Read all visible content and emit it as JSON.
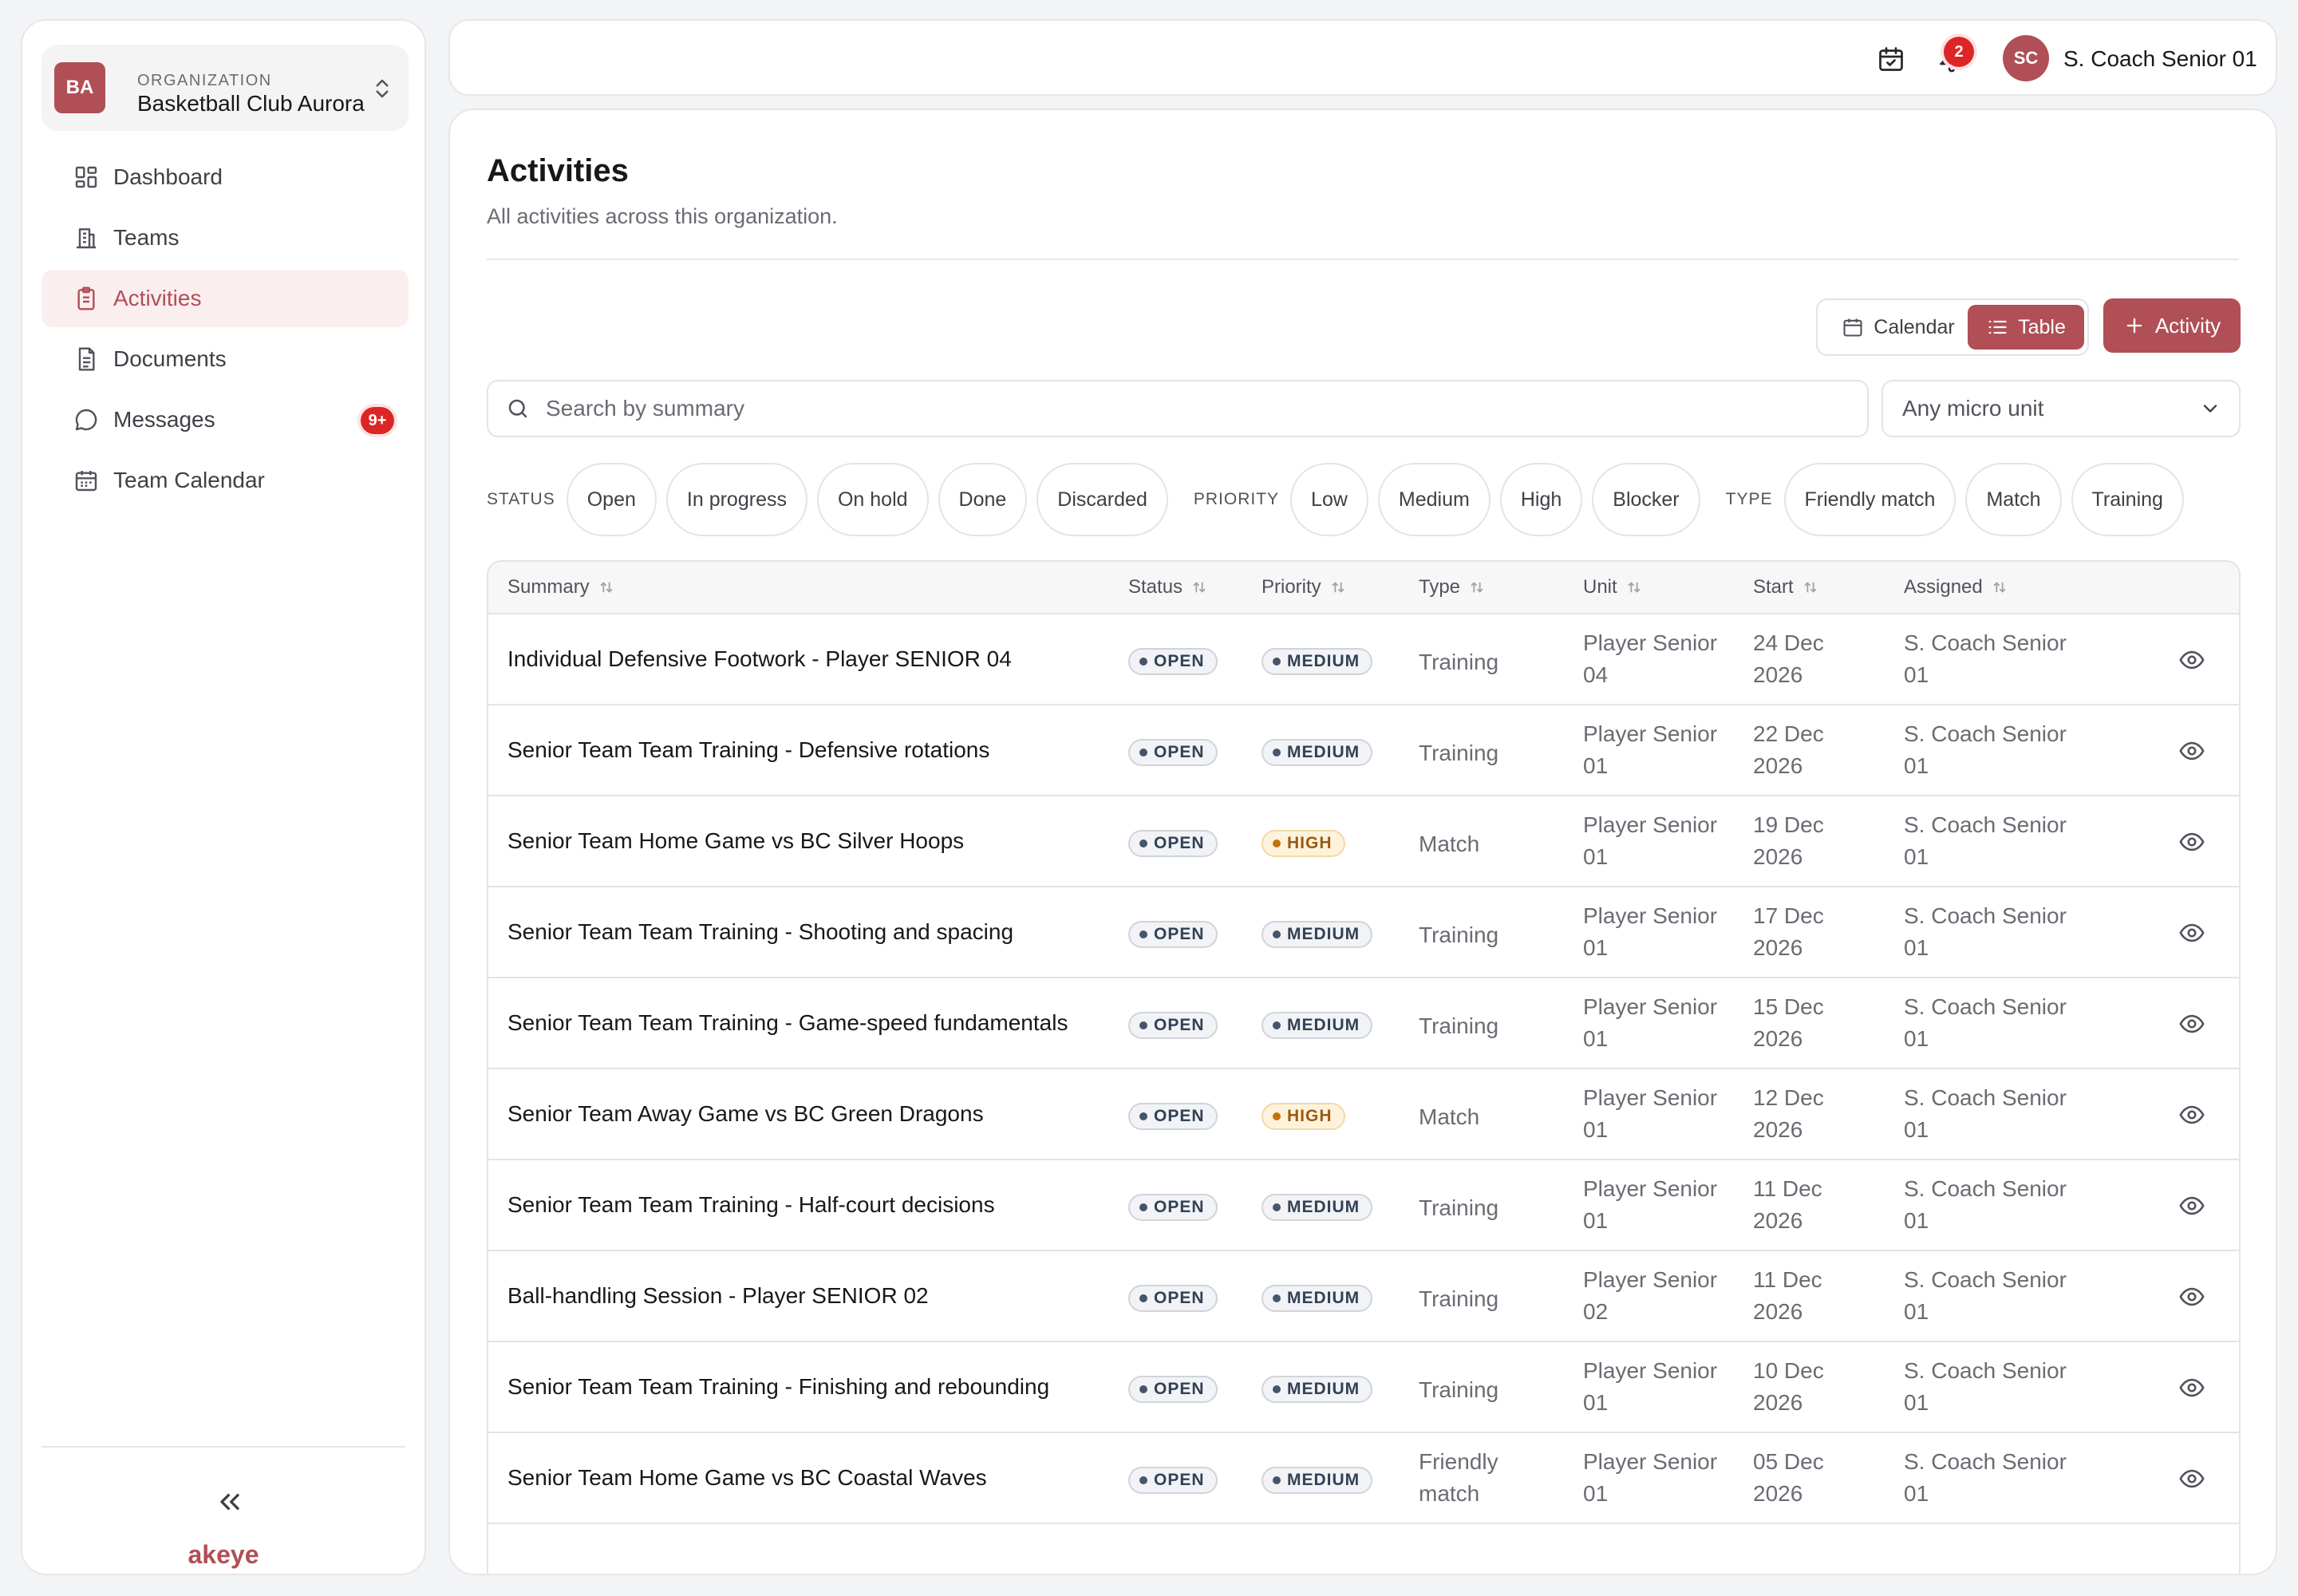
{
  "sidebar": {
    "org_initials": "BA",
    "org_kicker": "ORGANIZATION",
    "org_name": "Basketball Club Aurora",
    "nav": [
      {
        "label": "Dashboard",
        "icon": "dashboard-icon"
      },
      {
        "label": "Teams",
        "icon": "building-icon"
      },
      {
        "label": "Activities",
        "icon": "clipboard-icon",
        "active": true
      },
      {
        "label": "Documents",
        "icon": "document-icon"
      },
      {
        "label": "Messages",
        "icon": "message-icon",
        "badge": "9+"
      },
      {
        "label": "Team Calendar",
        "icon": "calendar-icon"
      }
    ],
    "collapse_glyph": "«",
    "brand": "akeye"
  },
  "topbar": {
    "notification_count": "2",
    "user_initials": "SC",
    "user_name": "S. Coach Senior 01"
  },
  "page": {
    "title": "Activities",
    "subtitle": "All activities across this organization.",
    "view_calendar_label": "Calendar",
    "view_table_label": "Table",
    "add_button_label": "Activity",
    "search_placeholder": "Search by summary",
    "unit_select_value": "Any micro unit"
  },
  "filters": {
    "status_label": "STATUS",
    "status_options": [
      "Open",
      "In progress",
      "On hold",
      "Done",
      "Discarded"
    ],
    "priority_label": "PRIORITY",
    "priority_options": [
      "Low",
      "Medium",
      "High",
      "Blocker"
    ],
    "type_label": "TYPE",
    "type_options": [
      "Friendly match",
      "Match",
      "Training"
    ]
  },
  "table": {
    "columns": [
      "Summary",
      "Status",
      "Priority",
      "Type",
      "Unit",
      "Start",
      "Assigned"
    ],
    "rows": [
      {
        "summary": "Individual Defensive Footwork - Player SENIOR 04",
        "status": "OPEN",
        "priority": "MEDIUM",
        "type": "Training",
        "unit": "Player Senior 04",
        "start": "24 Dec 2026",
        "assigned": "S. Coach Senior 01"
      },
      {
        "summary": "Senior Team Team Training - Defensive rotations",
        "status": "OPEN",
        "priority": "MEDIUM",
        "type": "Training",
        "unit": "Player Senior 01",
        "start": "22 Dec 2026",
        "assigned": "S. Coach Senior 01"
      },
      {
        "summary": "Senior Team Home Game vs BC Silver Hoops",
        "status": "OPEN",
        "priority": "HIGH",
        "type": "Match",
        "unit": "Player Senior 01",
        "start": "19 Dec 2026",
        "assigned": "S. Coach Senior 01"
      },
      {
        "summary": "Senior Team Team Training - Shooting and spacing",
        "status": "OPEN",
        "priority": "MEDIUM",
        "type": "Training",
        "unit": "Player Senior 01",
        "start": "17 Dec 2026",
        "assigned": "S. Coach Senior 01"
      },
      {
        "summary": "Senior Team Team Training - Game-speed fundamentals",
        "status": "OPEN",
        "priority": "MEDIUM",
        "type": "Training",
        "unit": "Player Senior 01",
        "start": "15 Dec 2026",
        "assigned": "S. Coach Senior 01"
      },
      {
        "summary": "Senior Team Away Game vs BC Green Dragons",
        "status": "OPEN",
        "priority": "HIGH",
        "type": "Match",
        "unit": "Player Senior 01",
        "start": "12 Dec 2026",
        "assigned": "S. Coach Senior 01"
      },
      {
        "summary": "Senior Team Team Training - Half-court decisions",
        "status": "OPEN",
        "priority": "MEDIUM",
        "type": "Training",
        "unit": "Player Senior 01",
        "start": "11 Dec 2026",
        "assigned": "S. Coach Senior 01"
      },
      {
        "summary": "Ball-handling Session - Player SENIOR 02",
        "status": "OPEN",
        "priority": "MEDIUM",
        "type": "Training",
        "unit": "Player Senior 02",
        "start": "11 Dec 2026",
        "assigned": "S. Coach Senior 01"
      },
      {
        "summary": "Senior Team Team Training - Finishing and rebounding",
        "status": "OPEN",
        "priority": "MEDIUM",
        "type": "Training",
        "unit": "Player Senior 01",
        "start": "10 Dec 2026",
        "assigned": "S. Coach Senior 01"
      },
      {
        "summary": "Senior Team Home Game vs BC Coastal Waves",
        "status": "OPEN",
        "priority": "MEDIUM",
        "type": "Friendly match",
        "unit": "Player Senior 01",
        "start": "05 Dec 2026",
        "assigned": "S. Coach Senior 01"
      }
    ]
  },
  "colors": {
    "brand": "#b04f56",
    "badge": "#dc2626",
    "pill_medium": "#334155",
    "pill_high": "#9a5b10"
  }
}
